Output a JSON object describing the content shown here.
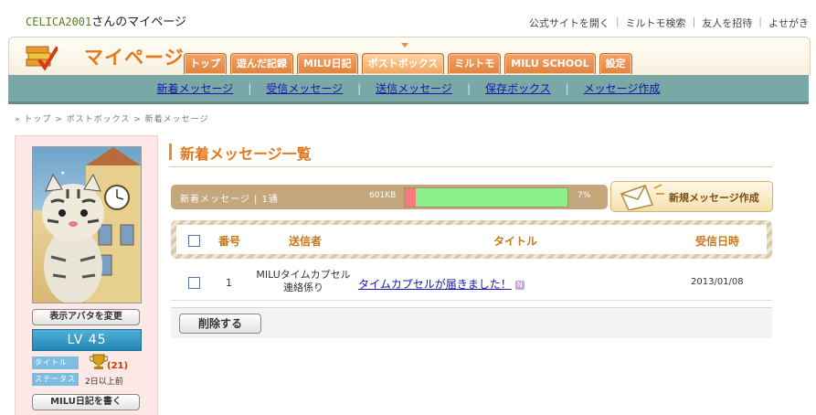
{
  "header": {
    "user_name": "CELICA2001",
    "user_suffix": "さんのマイページ",
    "links": [
      "公式サイトを開く",
      "ミルトモ検索",
      "友人を招待",
      "よせがき"
    ]
  },
  "mainnav": {
    "logo_text": "マイページ",
    "tabs": [
      "トップ",
      "遊んだ記録",
      "MILU日記",
      "ポストボックス",
      "ミルトモ",
      "MILU SCHOOL",
      "設定"
    ],
    "active_tab": "ポストボックス"
  },
  "subnav": {
    "items": [
      "新着メッセージ",
      "受信メッセージ",
      "送信メッセージ",
      "保存ボックス",
      "メッセージ作成"
    ]
  },
  "breadcrumb": "» トップ > ポストボックス > 新着メッセージ",
  "sidebar": {
    "change_avatar": "表示アバタを変更",
    "level": "LV 45",
    "title_label": "タイトル",
    "title_count": "(21)",
    "status_label": "ステータス",
    "status_value": "2日以上前",
    "write_diary": "MILU日記を書く"
  },
  "main": {
    "heading": "新着メッセージ一覧",
    "quota": {
      "label": "新着メッセージ | 1通",
      "size": "601KB",
      "percent_text": "7%",
      "used_fraction": 0.07
    },
    "new_message_button": "新規メッセージ作成",
    "table": {
      "headers": [
        "番号",
        "送信者",
        "タイトル",
        "受信日時"
      ],
      "rows": [
        {
          "number": "1",
          "sender_line1": "MILUタイムカプセル",
          "sender_line2": "連絡係り",
          "title": "タイムカプセルが届きました！",
          "badge": "N",
          "date": "2013/01/08"
        }
      ]
    },
    "delete_button": "削除する"
  },
  "colors": {
    "accent_orange": "#e0781e",
    "subnav_teal": "#7aa8a6",
    "quota_bar": "#c4a77d",
    "link_blue": "#1515b0"
  }
}
